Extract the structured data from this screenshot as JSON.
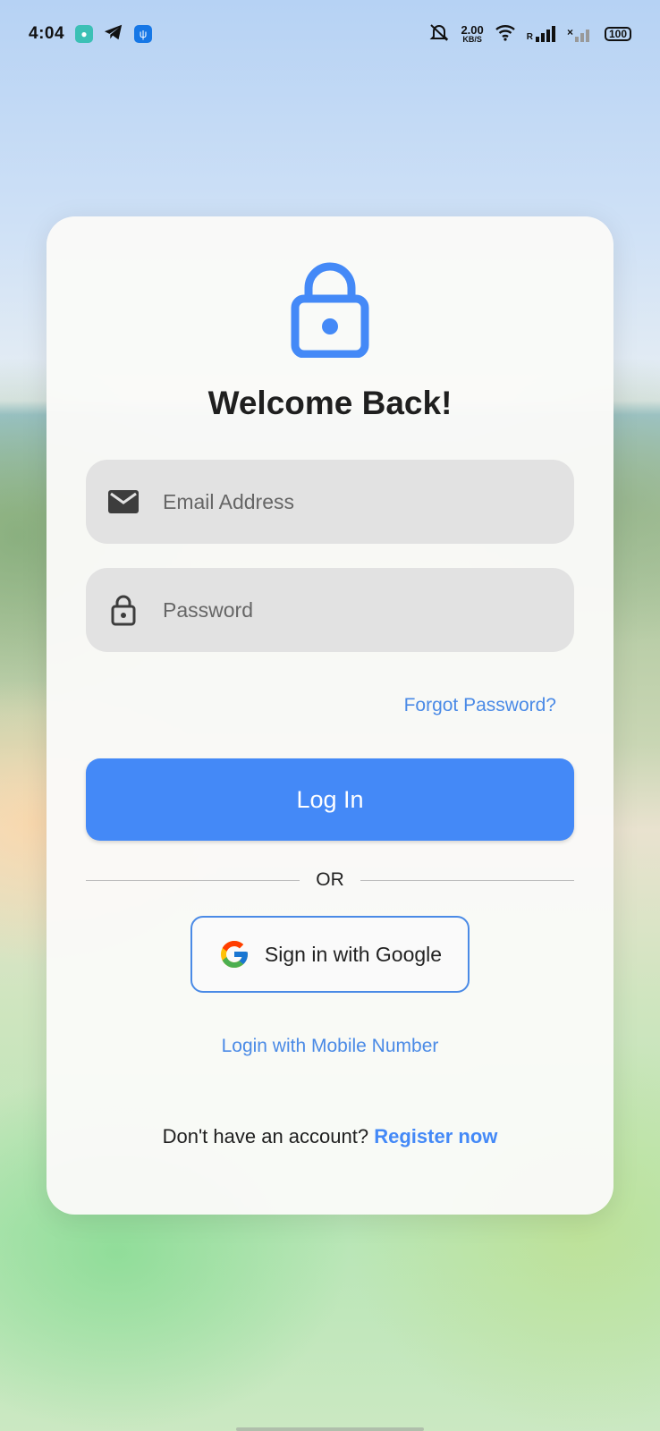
{
  "status_bar": {
    "time": "4:04",
    "net_speed_value": "2.00",
    "net_speed_unit": "KB/S",
    "signal_roaming_label": "R",
    "sim2_label": "×",
    "battery_level": "100"
  },
  "login": {
    "title": "Welcome Back!",
    "email_placeholder": "Email Address",
    "password_placeholder": "Password",
    "forgot_password": "Forgot Password?",
    "login_button": "Log In",
    "divider_text": "OR",
    "google_button": "Sign in with Google",
    "mobile_login": "Login with Mobile Number",
    "register_prompt": "Don't have an account?",
    "register_link": "Register now"
  },
  "colors": {
    "accent": "#4489f7",
    "link": "#4a8ae6",
    "field_bg": "#e2e2e2"
  }
}
